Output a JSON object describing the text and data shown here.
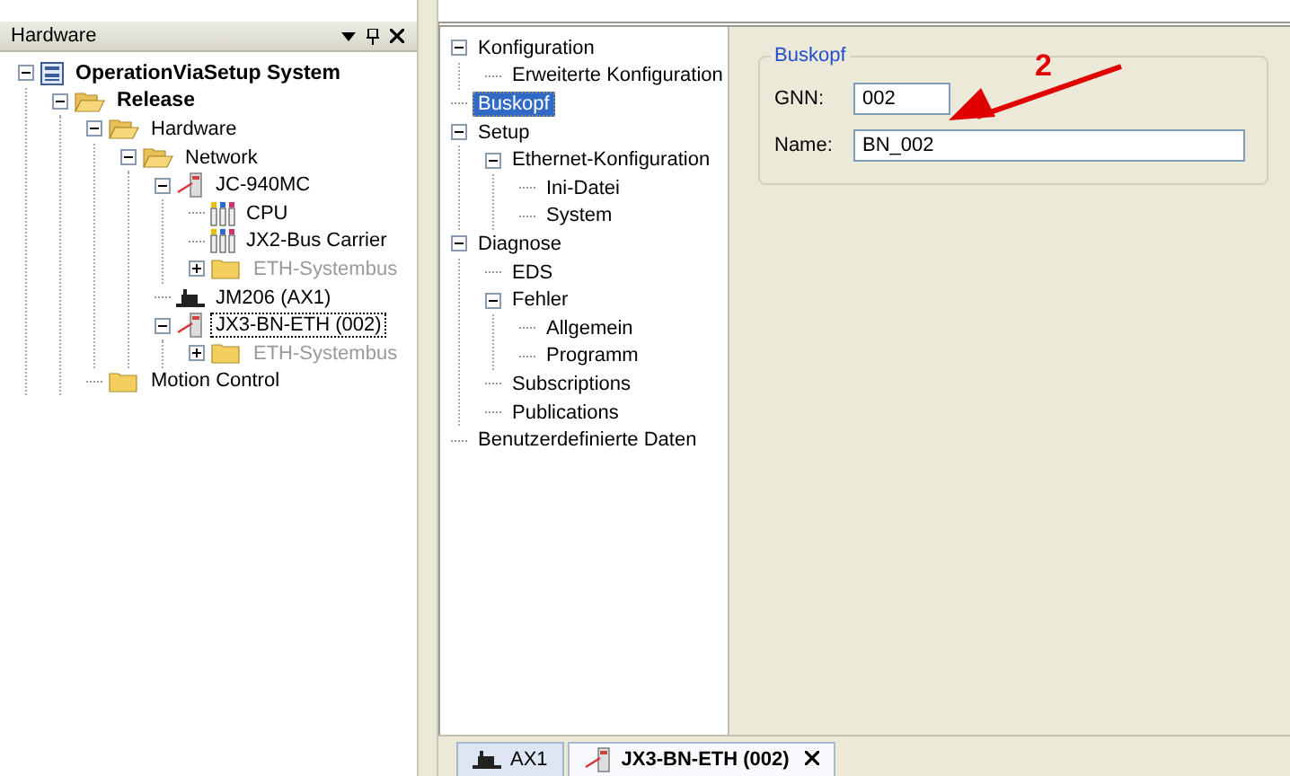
{
  "hardware_panel": {
    "title": "Hardware",
    "tree": [
      {
        "label": "OperationViaSetup System",
        "kind": "system",
        "bold": true,
        "disabled": false,
        "selected": false,
        "expanded": true,
        "children": [
          {
            "label": "Release",
            "kind": "folder-open",
            "bold": true,
            "disabled": false,
            "selected": false,
            "expanded": true,
            "children": [
              {
                "label": "Hardware",
                "kind": "folder-open",
                "bold": false,
                "disabled": false,
                "selected": false,
                "expanded": true,
                "children": [
                  {
                    "label": "Network",
                    "kind": "folder-open",
                    "bold": false,
                    "disabled": false,
                    "selected": false,
                    "expanded": true,
                    "children": [
                      {
                        "label": "JC-940MC",
                        "kind": "device",
                        "bold": false,
                        "disabled": false,
                        "selected": false,
                        "expanded": true,
                        "children": [
                          {
                            "label": "CPU",
                            "kind": "module",
                            "bold": false,
                            "disabled": false,
                            "selected": false
                          },
                          {
                            "label": "JX2-Bus Carrier",
                            "kind": "module",
                            "bold": false,
                            "disabled": false,
                            "selected": false
                          },
                          {
                            "label": "ETH-Systembus",
                            "kind": "folder",
                            "bold": false,
                            "disabled": true,
                            "selected": false,
                            "expanded": false
                          }
                        ]
                      },
                      {
                        "label": "JM206 (AX1)",
                        "kind": "motor",
                        "bold": false,
                        "disabled": false,
                        "selected": false
                      },
                      {
                        "label": "JX3-BN-ETH (002)",
                        "kind": "device",
                        "bold": false,
                        "disabled": false,
                        "selected": true,
                        "expanded": true,
                        "children": [
                          {
                            "label": "ETH-Systembus",
                            "kind": "folder",
                            "bold": false,
                            "disabled": true,
                            "selected": false,
                            "expanded": false
                          }
                        ]
                      }
                    ]
                  }
                ]
              },
              {
                "label": "Motion Control",
                "kind": "folder",
                "bold": false,
                "disabled": false,
                "selected": false
              }
            ]
          }
        ]
      }
    ]
  },
  "config_tree": [
    {
      "label": "Konfiguration",
      "selected": false,
      "expanded": true,
      "children": [
        {
          "label": "Erweiterte Konfiguration",
          "selected": false
        }
      ]
    },
    {
      "label": "Buskopf",
      "selected": true
    },
    {
      "label": "Setup",
      "selected": false,
      "expanded": true,
      "children": [
        {
          "label": "Ethernet-Konfiguration",
          "selected": false,
          "expanded": true,
          "children": [
            {
              "label": "Ini-Datei",
              "selected": false
            },
            {
              "label": "System",
              "selected": false
            }
          ]
        }
      ]
    },
    {
      "label": "Diagnose",
      "selected": false,
      "expanded": true,
      "children": [
        {
          "label": "EDS",
          "selected": false
        },
        {
          "label": "Fehler",
          "selected": false,
          "expanded": true,
          "children": [
            {
              "label": "Allgemein",
              "selected": false
            },
            {
              "label": "Programm",
              "selected": false
            }
          ]
        },
        {
          "label": "Subscriptions",
          "selected": false
        },
        {
          "label": "Publications",
          "selected": false
        }
      ]
    },
    {
      "label": "Benutzerdefinierte Daten",
      "selected": false
    }
  ],
  "group": {
    "title": "Buskopf",
    "fields": [
      {
        "label": "GNN:",
        "value": "002",
        "kind": "short"
      },
      {
        "label": "Name:",
        "value": "BN_002",
        "kind": "long"
      }
    ]
  },
  "annotation": {
    "label": "2"
  },
  "document_tabs": [
    {
      "label": "AX1",
      "kind": "motor",
      "selected": false,
      "closable": false
    },
    {
      "label": "JX3-BN-ETH (002)",
      "kind": "device",
      "selected": true,
      "closable": true
    }
  ]
}
